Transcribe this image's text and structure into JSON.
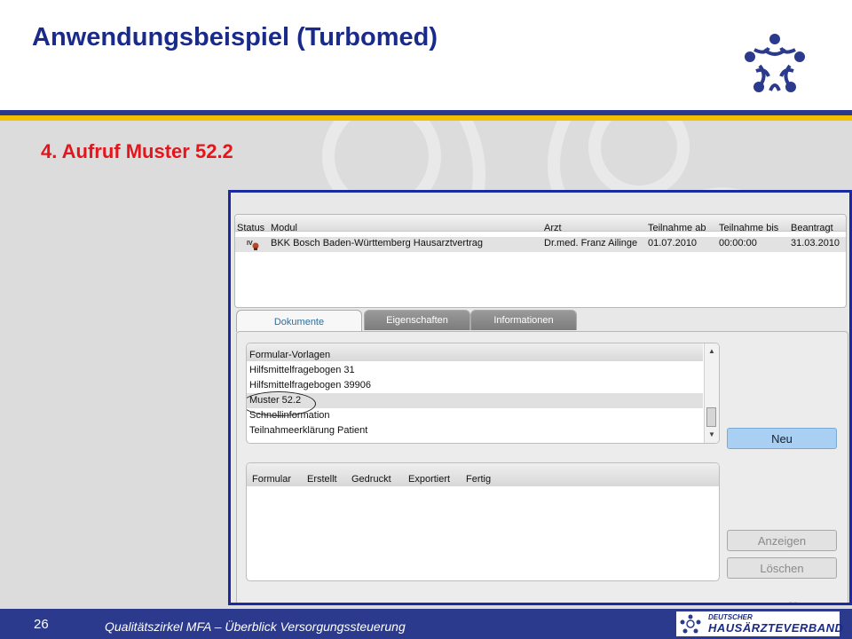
{
  "slide": {
    "title": "Anwendungsbeispiel (Turbomed)",
    "subtitle": "4. Aufruf Muster 52.2",
    "page_number": "26",
    "footer_text": "Qualitätszirkel MFA – Überblick Versorgungssteuerung",
    "footer_logo_small": "DEUTSCHER",
    "footer_logo_big": "HAUSÄRZTEVERBAND",
    "colors": {
      "title": "#1a2a8a",
      "subtitle": "#e3161b",
      "band_blue": "#2b3a8c",
      "band_yellow": "#f2c200"
    }
  },
  "modules": {
    "columns": [
      "Status",
      "Modul",
      "Arzt",
      "Teilnahme ab",
      "Teilnahme bis",
      "Beantragt"
    ],
    "rows": [
      {
        "status_icon": "status-icon",
        "modul": "BKK Bosch Baden-Württemberg Hausarztvertrag",
        "arzt": "Dr.med. Franz Ailinge",
        "teilnahme_ab": "01.07.2010",
        "teilnahme_bis": "00:00:00",
        "beantragt": "31.03.2010"
      }
    ]
  },
  "tabs": [
    {
      "label": "Dokumente",
      "active": true
    },
    {
      "label": "Eigenschaften",
      "active": false
    },
    {
      "label": "Informationen",
      "active": false
    }
  ],
  "formular_vorlagen": {
    "header": "Formular-Vorlagen",
    "items": [
      "Hilfsmittelfragebogen 31",
      "Hilfsmittelfragebogen 39906",
      "Muster 52.2",
      "Schnellinformation",
      "Teilnahmeerklärung Patient"
    ],
    "selected_index": 2
  },
  "documents": {
    "columns": [
      "Formular",
      "Erstellt",
      "Gedruckt",
      "Exportiert",
      "Fertig"
    ]
  },
  "buttons": {
    "new": "Neu",
    "show": "Anzeigen",
    "delete": "Löschen"
  },
  "screenshot_page_mark": "26"
}
